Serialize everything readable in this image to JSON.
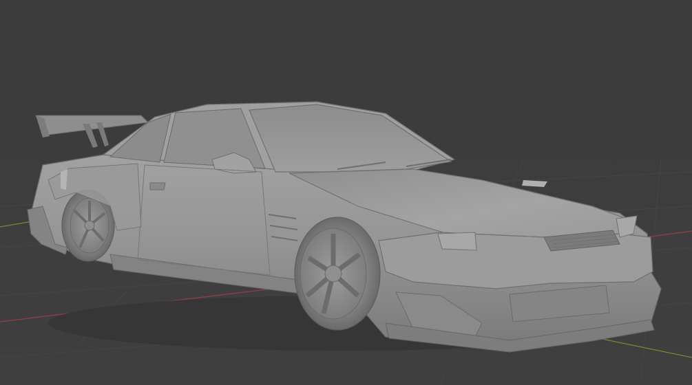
{
  "viewport": {
    "background_color": "#3d3d3d",
    "grid_color": "#454545",
    "x_axis_color": "#9b3c47",
    "y_axis_color": "#6f8f3a",
    "object": {
      "name": "3d-car-model",
      "description_icon": "car-model-mesh",
      "shading": "solid",
      "body_color": "#9a9a9a"
    }
  }
}
